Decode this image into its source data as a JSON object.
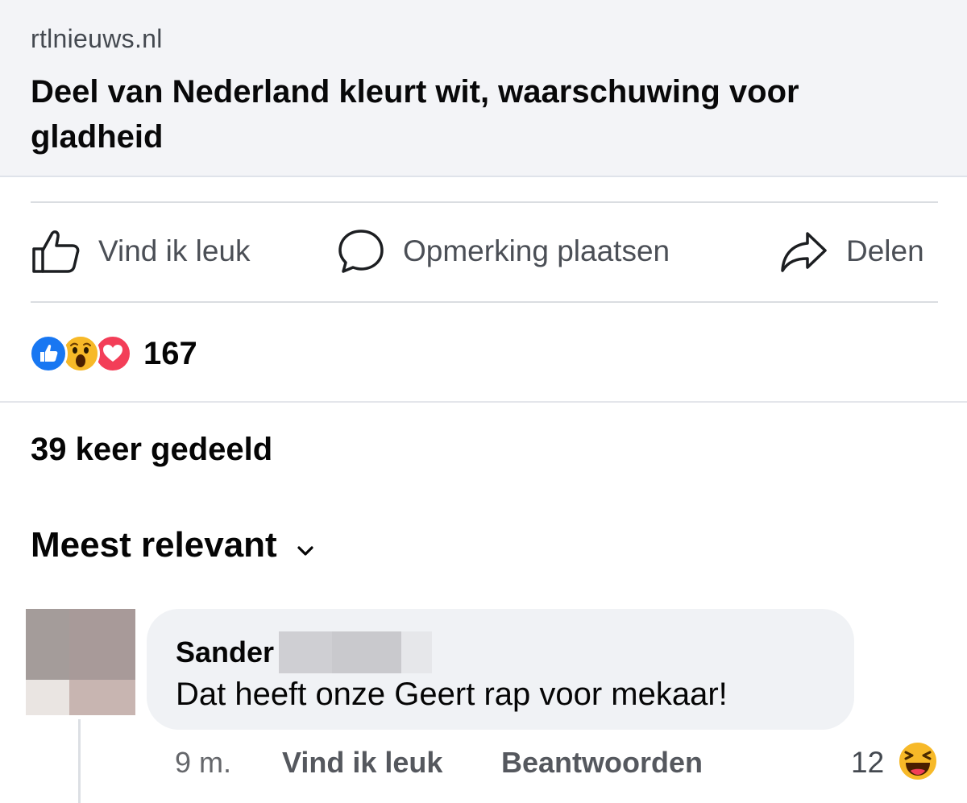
{
  "link_preview": {
    "domain": "rtlnieuws.nl",
    "headline": "Deel van Nederland kleurt wit, waarschuwing voor gladheid"
  },
  "actions": {
    "like_label": "Vind ik leuk",
    "comment_label": "Opmerking plaatsen",
    "share_label": "Delen"
  },
  "reactions": {
    "types": [
      "like",
      "wow",
      "love"
    ],
    "count": "167"
  },
  "shares_label": "39 keer gedeeld",
  "sort": {
    "label": "Meest relevant"
  },
  "comment": {
    "author": "Sander",
    "text": "Dat heeft onze Geert rap voor mekaar!",
    "time": "9 m.",
    "like_label": "Vind ik leuk",
    "reply_label": "Beantwoorden",
    "reaction_count": "12",
    "reaction_type": "haha"
  },
  "colors": {
    "like_blue": "#1877f2",
    "wow_yellow": "#f7b928",
    "love_red": "#f33e58",
    "preview_bg": "#f3f4f7",
    "bubble_bg": "#f0f2f5"
  }
}
